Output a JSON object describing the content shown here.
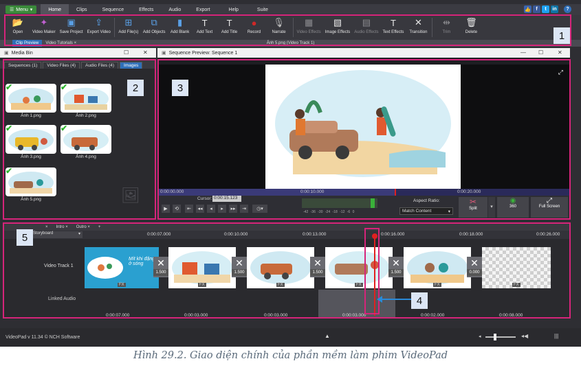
{
  "menubar": {
    "menu_label": "Menu",
    "tabs": [
      "Home",
      "Clips",
      "Sequence",
      "Effects",
      "Audio",
      "Export",
      "Help",
      "Suite"
    ],
    "active_tab": "Home"
  },
  "toolbar": {
    "items": [
      {
        "label": "Open",
        "icon": "folder-icon"
      },
      {
        "label": "Video Maker",
        "icon": "wizard-icon"
      },
      {
        "label": "Save Project",
        "icon": "save-icon"
      },
      {
        "label": "Export Video",
        "icon": "export-icon"
      },
      {
        "label": "Add File(s)",
        "icon": "add-file-icon"
      },
      {
        "label": "Add Objects",
        "icon": "add-objects-icon"
      },
      {
        "label": "Add Blank",
        "icon": "add-blank-icon"
      },
      {
        "label": "Add Text",
        "icon": "text-icon"
      },
      {
        "label": "Add Title",
        "icon": "title-icon"
      },
      {
        "label": "Record",
        "icon": "record-icon"
      },
      {
        "label": "Narrate",
        "icon": "microphone-icon"
      },
      {
        "label": "Video Effects",
        "icon": "video-effects-icon"
      },
      {
        "label": "Image Effects",
        "icon": "image-effects-icon"
      },
      {
        "label": "Audio Effects",
        "icon": "audio-effects-icon"
      },
      {
        "label": "Text Effects",
        "icon": "text-effects-icon"
      },
      {
        "label": "Transition",
        "icon": "transition-icon"
      },
      {
        "label": "Trim",
        "icon": "trim-icon"
      },
      {
        "label": "Delete",
        "icon": "trash-icon"
      }
    ]
  },
  "clipstrip": {
    "tabs": [
      "Clip Preview",
      "Video Tutorials"
    ],
    "title": "Ảnh 5.png (Video Track 1)"
  },
  "mediabin": {
    "title": "Media Bin",
    "tabs": [
      "Sequences",
      "Video Files",
      "Audio Files",
      "Images"
    ],
    "tab_counts": [
      "(1)",
      "(4)",
      "(4)",
      ""
    ],
    "items": [
      "Ảnh 1.png",
      "Ảnh 2.png",
      "Ảnh 3.png",
      "Ảnh 4.png",
      "Ảnh 5.png"
    ]
  },
  "preview": {
    "title": "Sequence Preview: Sequence 1",
    "scrub_times": [
      "0:00:00.000",
      "0:00:10.000",
      "0:00:20.000"
    ],
    "cursor_label": "Cursor:",
    "cursor_value": "0:00:15.123",
    "meter_ticks": [
      "-42",
      "-36",
      "-30",
      "-24",
      "-18",
      "-12",
      "-6",
      "0"
    ],
    "aspect_label": "Aspect Ratio:",
    "aspect_value": "Match Content",
    "split_label": "Split",
    "vr_label": "360",
    "fullscreen_label": "Full Screen"
  },
  "timeline": {
    "tabs": [
      "Intro",
      "Outro"
    ],
    "storyboard_label": "Storyboard",
    "ruler_times": [
      "0:00:07.000",
      "0:00:10.000",
      "0:00:13.000",
      "0:00:16.000",
      "0:00:18.000",
      "0:00:26.000"
    ],
    "track_label": "Video Track 1",
    "linked_label": "Linked Audio",
    "transitions": [
      "1.500",
      "1.500",
      "1.500",
      "1.500",
      "0.000"
    ],
    "fx_label": "FX",
    "intro_text": "Mít khi đặng ở sóng",
    "clip_durations": [
      "0:00:07.000",
      "0:00:03.000",
      "0:00:03.000",
      "0:00:03.000",
      "0:00:02.000",
      "0:00:08.000"
    ]
  },
  "statusbar": {
    "version": "VideoPad v 11.34 © NCH Software"
  },
  "callouts": [
    "1",
    "2",
    "3",
    "4",
    "5"
  ],
  "caption": "Hình 29.2. Giao diện chính của phần mềm làm phim VideoPad",
  "colors": {
    "highlight": "#d6247a",
    "accent": "#2f6fb8",
    "check": "#2fb52f",
    "playhead": "#e02020"
  }
}
